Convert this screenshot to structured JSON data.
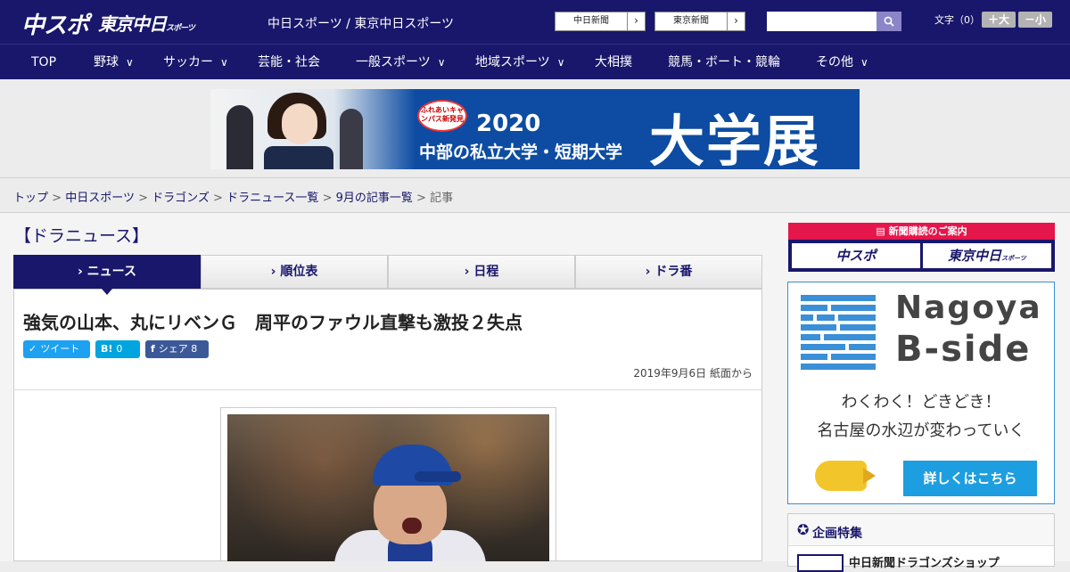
{
  "header": {
    "logo_main": "中スポ",
    "logo_sub": "東京中日",
    "logo_sub_small": "スポーツ",
    "site_names": "中日スポーツ / 東京中日スポーツ",
    "paper_buttons": [
      {
        "label": "中日新聞",
        "arrow": "›"
      },
      {
        "label": "東京新聞",
        "arrow": "›"
      }
    ],
    "search": {
      "value": "",
      "placeholder": "",
      "button_icon": "search-icon"
    },
    "font_size": {
      "label": "文字（0）",
      "larger": "＋大",
      "smaller": "－小"
    }
  },
  "nav": {
    "items": [
      {
        "label": "TOP",
        "has_menu": false
      },
      {
        "label": "野球",
        "has_menu": true
      },
      {
        "label": "サッカー",
        "has_menu": true
      },
      {
        "label": "芸能・社会",
        "has_menu": false
      },
      {
        "label": "一般スポーツ",
        "has_menu": true
      },
      {
        "label": "地域スポーツ",
        "has_menu": true
      },
      {
        "label": "大相撲",
        "has_menu": false
      },
      {
        "label": "競馬・ボート・競輪",
        "has_menu": false
      },
      {
        "label": "その他",
        "has_menu": true
      }
    ],
    "chevron": "∨"
  },
  "banner": {
    "badge": "ふれあいキャンパス新発見",
    "year": "2020",
    "subtitle": "中部の私立大学・短期大学",
    "big": "大学展"
  },
  "breadcrumb": {
    "links": [
      "トップ",
      "中日スポーツ",
      "ドラゴンズ",
      "ドラニュース一覧",
      "9月の記事一覧"
    ],
    "current": "記事",
    "separator": ">"
  },
  "section": {
    "title": "【ドラニュース】"
  },
  "tabs": [
    {
      "label": "ニュース",
      "active": true
    },
    {
      "label": "順位表",
      "active": false
    },
    {
      "label": "日程",
      "active": false
    },
    {
      "label": "ドラ番",
      "active": false
    }
  ],
  "tab_prefix": "›",
  "article": {
    "headline": "強気の山本、丸にリベンＧ　周平のファウル直撃も激投２失点",
    "share": [
      {
        "icon": "twitter-icon",
        "glyph": "✓",
        "label": "ツイート",
        "color": "#1da1f2"
      },
      {
        "icon": "hatena-icon",
        "glyph": "B!",
        "label": "0",
        "color": "#00a4de"
      },
      {
        "icon": "facebook-icon",
        "glyph": "f",
        "label": "シェア 8",
        "color": "#3b5998"
      }
    ],
    "date": "2019年9月6日 紙面から"
  },
  "sidebar": {
    "subscribe": {
      "header": "新聞購読のご案内",
      "buttons": [
        {
          "label": "中スポ",
          "small": ""
        },
        {
          "label": "東京中日",
          "small": "スポーツ"
        }
      ]
    },
    "ad": {
      "title1": "Nagoya",
      "title2": "B-side",
      "line1": "わくわく！どきどき！",
      "line2": "名古屋の水辺が変わっていく",
      "cta": "詳しくはこちら"
    },
    "feature": {
      "title": "企画特集",
      "item": "中日新聞ドラゴンズショップ"
    }
  },
  "colors": {
    "brand_navy": "#19176b",
    "accent_red": "#e4164c",
    "ad_blue": "#3a8fd6"
  }
}
